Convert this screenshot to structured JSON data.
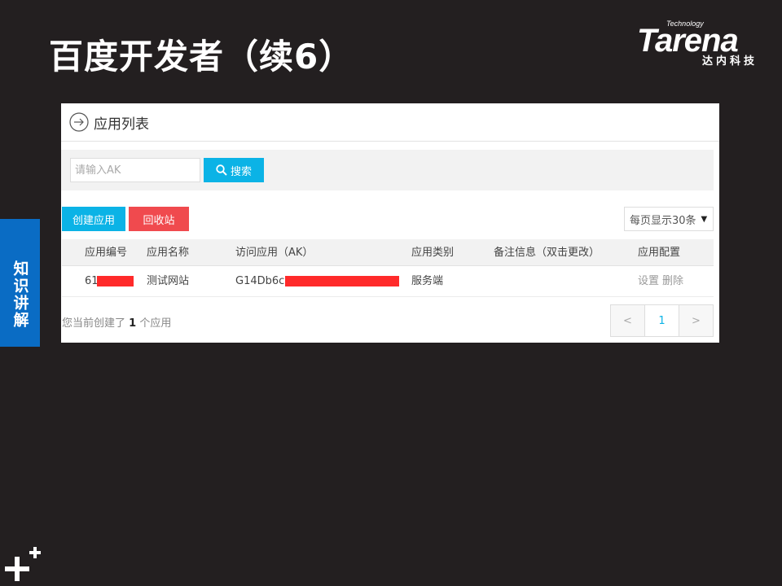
{
  "slide": {
    "title": "百度开发者（续6）",
    "side_tab": "知识讲解"
  },
  "logo": {
    "technology": "Technology",
    "word": "Tarena",
    "subtitle": "达内科技"
  },
  "panel": {
    "title": "应用列表",
    "search": {
      "placeholder": "请输入AK",
      "button_label": "搜索"
    },
    "buttons": {
      "create": "创建应用",
      "recycle": "回收站"
    },
    "page_size": {
      "selected": "每页显示30条"
    },
    "table": {
      "headers": [
        "应用编号",
        "应用名称",
        "访问应用（AK）",
        "应用类别",
        "备注信息（双击更改）",
        "应用配置"
      ],
      "rows": [
        {
          "id": "61",
          "name": "测试网站",
          "ak": "G14Db6c",
          "category": "服务端",
          "note": "",
          "settings": "设置",
          "delete": "删除"
        }
      ]
    },
    "footer": {
      "prefix": "您当前创建了",
      "count": "1",
      "suffix": "个应用"
    },
    "pagination": {
      "prev": "<",
      "current": "1",
      "next": ">"
    }
  },
  "colors": {
    "background": "#231f20",
    "accent_blue": "#0bb3e6",
    "danger_red": "#f04a4e",
    "side_tab_blue": "#0a6cc4"
  }
}
